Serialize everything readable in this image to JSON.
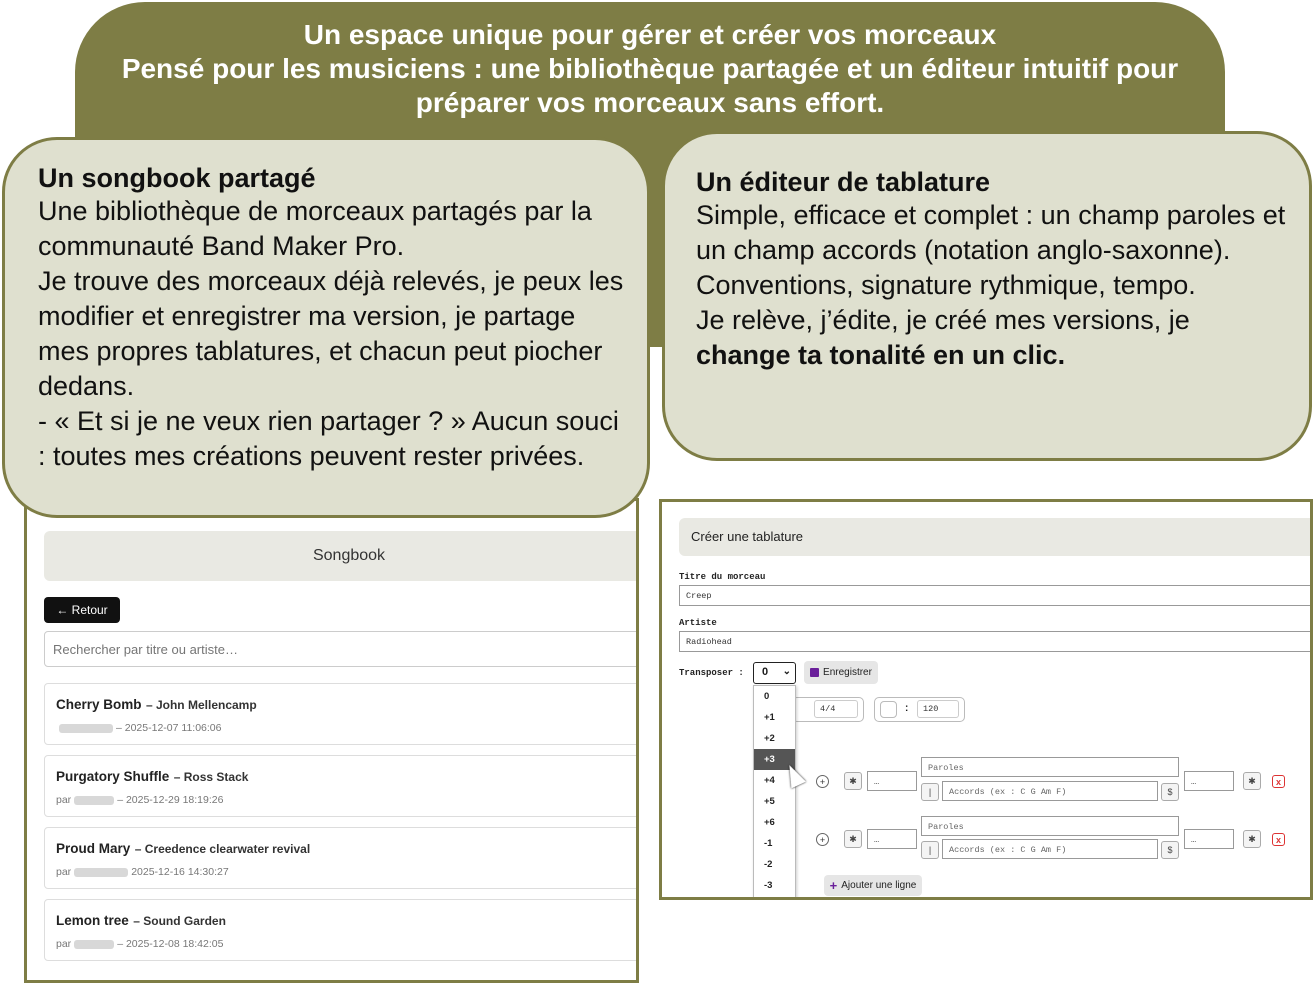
{
  "banner": {
    "line1": "Un espace unique pour gérer et créer vos morceaux",
    "line2": "Pensé pour les musiciens : une bibliothèque partagée et un éditeur intuitif pour préparer vos morceaux sans effort."
  },
  "left_bubble": {
    "title": "Un songbook partagé",
    "p1": "Une bibliothèque de morceaux partagés par la communauté Band Maker Pro.",
    "p2": "Je trouve des morceaux déjà relevés, je peux les modifier et enregistrer ma version, je partage mes propres tablatures, et chacun peut piocher dedans.",
    "p3": "- « Et si je ne veux rien partager ? » Aucun souci : toutes mes créations peuvent rester privées."
  },
  "right_bubble": {
    "title": "Un éditeur de tablature",
    "p1": "Simple, efficace et complet : un champ paroles et un champ accords (notation anglo-saxonne).",
    "p2": "Conventions, signature rythmique, tempo.",
    "p3": "Je relève, j’édite, je créé mes versions, je",
    "p3_bold": "change ta tonalité en un clic."
  },
  "songbook": {
    "header": "Songbook",
    "back_label": "← Retour",
    "search_placeholder": "Rechercher par titre ou artiste…",
    "items": [
      {
        "title": "Cherry Bomb",
        "artist": "– John Mellencamp",
        "prefix": "",
        "date": "– 2025-12-07 11:06:06"
      },
      {
        "title": "Purgatory Shuffle",
        "artist": "– Ross Stack",
        "prefix": "par",
        "date": "– 2025-12-29 18:19:26"
      },
      {
        "title": "Proud Mary",
        "artist": "– Creedence clearwater revival",
        "prefix": "par",
        "date": "2025-12-16 14:30:27"
      },
      {
        "title": "Lemon tree",
        "artist": "– Sound Garden",
        "prefix": "par",
        "date": "– 2025-12-08 18:42:05"
      }
    ]
  },
  "editor": {
    "header": "Créer une tablature",
    "title_label": "Titre du morceau",
    "title_value": "Creep",
    "artist_label": "Artiste",
    "artist_value": "Radiohead",
    "transpose_label": "Transposer :",
    "transpose_value": "0",
    "save_label": "Enregistrer",
    "signature_value": "4/4",
    "tempo_sep": ":",
    "tempo_value": "120",
    "transpose_options": [
      "0",
      "+1",
      "+2",
      "+3",
      "+4",
      "+5",
      "+6",
      "-1",
      "-2",
      "-3"
    ],
    "transpose_highlighted": "+3",
    "lines": [
      {
        "lyrics_placeholder": "Paroles",
        "chords_placeholder": "Accords (ex : C G Am F)",
        "conv_placeholder": "…",
        "conv_right_placeholder": "…",
        "bar_label": "|",
        "sep_label": "$",
        "add_label": "+",
        "remove_label": "x"
      },
      {
        "lyrics_placeholder": "Paroles",
        "chords_placeholder": "Accords (ex : C G Am F)",
        "conv_placeholder": "…",
        "conv_right_placeholder": "…",
        "bar_label": "|",
        "sep_label": "$",
        "add_label": "+",
        "remove_label": "x"
      }
    ],
    "add_line_label": "Ajouter une ligne",
    "add_line_icon": "+"
  },
  "colors": {
    "accent_olive": "#7e7d45",
    "bubble_bg": "#dfe0cf",
    "purple_icon": "#6a1f9a",
    "delete_red": "#dd3333"
  }
}
